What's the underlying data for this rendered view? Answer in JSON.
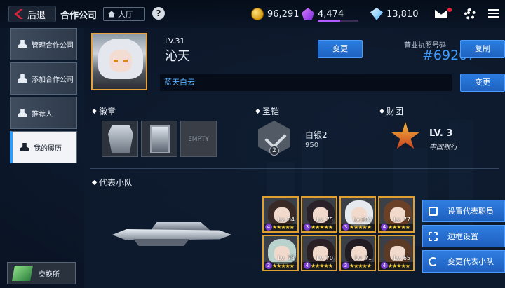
{
  "topbar": {
    "back_label": "后退",
    "page_title": "合作公司",
    "hall_label": "大厅",
    "help_symbol": "?",
    "coins": "96,291",
    "crystals": "4,474",
    "crystal_progress": 0.55,
    "gems": "13,810",
    "accent_color": "#2d9cff"
  },
  "sidebar": {
    "items": [
      {
        "label": "管理合作公司",
        "icon": "company-icon"
      },
      {
        "label": "添加合作公司",
        "icon": "add-user-icon"
      },
      {
        "label": "推荐人",
        "icon": "user-icon"
      },
      {
        "label": "我的履历",
        "icon": "profile-icon"
      }
    ],
    "active_index": 3,
    "exchange_label": "交换所"
  },
  "profile": {
    "level": "LV.31",
    "name": "沁天",
    "change_name_label": "变更",
    "license_label": "营业执照号码",
    "license_number": "#69207",
    "copy_label": "复制",
    "motto": "蓝天白云",
    "change_motto_label": "变更"
  },
  "sections": {
    "badges_title": "徽章",
    "rank_title": "圣铠",
    "corp_title": "财团",
    "team_title": "代表小队"
  },
  "badges": {
    "empty_label": "EMPTY"
  },
  "rank": {
    "tier_number": "2",
    "name": "白银2",
    "points": "950"
  },
  "corp": {
    "level": "LV. 3",
    "name": "中国银行"
  },
  "team": {
    "members": [
      {
        "level": "Lv. 84",
        "rank": "4",
        "stars": "★★★★★",
        "hair": "#3a2a25"
      },
      {
        "level": "Lv. 75",
        "rank": "3",
        "stars": "★★★★★",
        "hair": "#2a2228"
      },
      {
        "level": "Lv.100",
        "rank": "3",
        "stars": "★★★★★",
        "hair": "#e6e9ee"
      },
      {
        "level": "Lv. 77",
        "rank": "4",
        "stars": "★★★★★",
        "hair": "#6a4027"
      },
      {
        "level": "Lv. 78",
        "rank": "3",
        "stars": "★★★★★",
        "hair": "#b9d2cc"
      },
      {
        "level": "Lv. 70",
        "rank": "4",
        "stars": "★★★★★",
        "hair": "#2b2024"
      },
      {
        "level": "Lv. 71",
        "rank": "3",
        "stars": "★★★★★",
        "hair": "#211c22"
      },
      {
        "level": "Lv. 65",
        "rank": "4",
        "stars": "★★★★★",
        "hair": "#5b3a26"
      }
    ],
    "buttons": {
      "set_rep": "设置代表职员",
      "frame": "边框设置",
      "change_team": "变更代表小队"
    }
  }
}
